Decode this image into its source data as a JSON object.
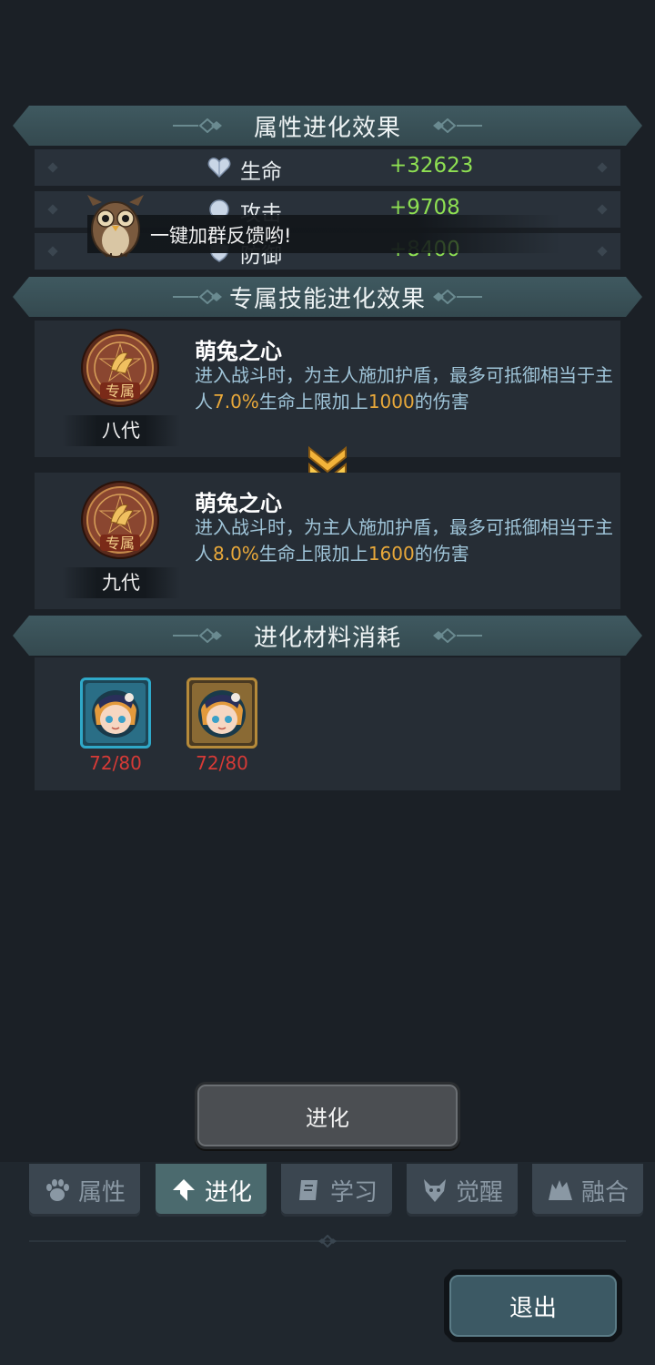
{
  "attr_section": {
    "title": "属性进化效果",
    "stats": [
      {
        "name": "生命",
        "value": "+32623"
      },
      {
        "name": "攻击",
        "value": "+9708"
      },
      {
        "name": "防御",
        "value": "+8400"
      }
    ]
  },
  "toast": {
    "text": "，一键加群反馈哟!"
  },
  "skill_section": {
    "title": "专属技能进化效果",
    "badge_text": "专属",
    "current": {
      "generation": "八代",
      "name": "萌兔之心",
      "desc_a": "进入战斗时，为主人施加护盾，最多可抵御相当于主人",
      "percent": "7.0%",
      "desc_b": "生命上限加上",
      "amount": "1000",
      "desc_c": "的伤害"
    },
    "next": {
      "generation": "九代",
      "name": "萌兔之心",
      "desc_a": "进入战斗时，为主人施加护盾，最多可抵御相当于主人",
      "percent": "8.0%",
      "desc_b": "生命上限加上",
      "amount": "1600",
      "desc_c": "的伤害"
    }
  },
  "material_section": {
    "title": "进化材料消耗",
    "items": [
      {
        "count": "72/80",
        "frame_color": "#2fa8c8"
      },
      {
        "count": "72/80",
        "frame_color": "#b58a3a"
      }
    ]
  },
  "evolve_button": {
    "label": "进化"
  },
  "nav": {
    "tabs": [
      {
        "label": "属性",
        "icon": "paw-icon",
        "active": false
      },
      {
        "label": "进化",
        "icon": "arrow-up-icon",
        "active": true
      },
      {
        "label": "学习",
        "icon": "book-icon",
        "active": false
      },
      {
        "label": "觉醒",
        "icon": "wolf-head-icon",
        "active": false
      },
      {
        "label": "融合",
        "icon": "fusion-icon",
        "active": false
      }
    ]
  },
  "exit_button": {
    "label": "退出"
  },
  "colors": {
    "stat_value": "#8ee052",
    "highlight": "#e8a83a",
    "material_count": "#d63a36",
    "desc_text": "#9fc4d8"
  }
}
